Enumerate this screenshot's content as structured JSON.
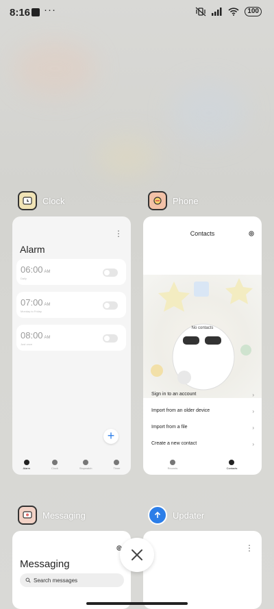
{
  "status_bar": {
    "time": "8:16",
    "dots": "···",
    "battery": "100"
  },
  "apps": {
    "clock": {
      "name": "Clock",
      "title": "Alarm",
      "alarms": [
        {
          "time": "06:00",
          "ampm": "AM",
          "sub": "Daily"
        },
        {
          "time": "07:00",
          "ampm": "AM",
          "sub": "Monday to Friday"
        },
        {
          "time": "08:00",
          "ampm": "AM",
          "sub": "Just once"
        }
      ],
      "fab": "+",
      "nav": [
        "Alarm",
        "Clock",
        "Stopwatch",
        "Timer"
      ]
    },
    "phone": {
      "name": "Phone",
      "title": "Contacts",
      "empty": "No contacts",
      "options": [
        "Sign in to an account",
        "Import from an older device",
        "Import from a file",
        "Create a new contact"
      ],
      "nav": [
        "Recents",
        "Contacts"
      ]
    },
    "messaging": {
      "name": "Messaging",
      "title": "Messaging",
      "search_placeholder": "Search messages"
    },
    "updater": {
      "name": "Updater"
    }
  },
  "icons": [
    "clock-app-icon",
    "phone-app-icon",
    "messaging-app-icon",
    "updater-app-icon",
    "close-icon",
    "gear-icon",
    "kebab-icon",
    "search-icon"
  ],
  "colors": {
    "accent": "#2c7ee8"
  }
}
